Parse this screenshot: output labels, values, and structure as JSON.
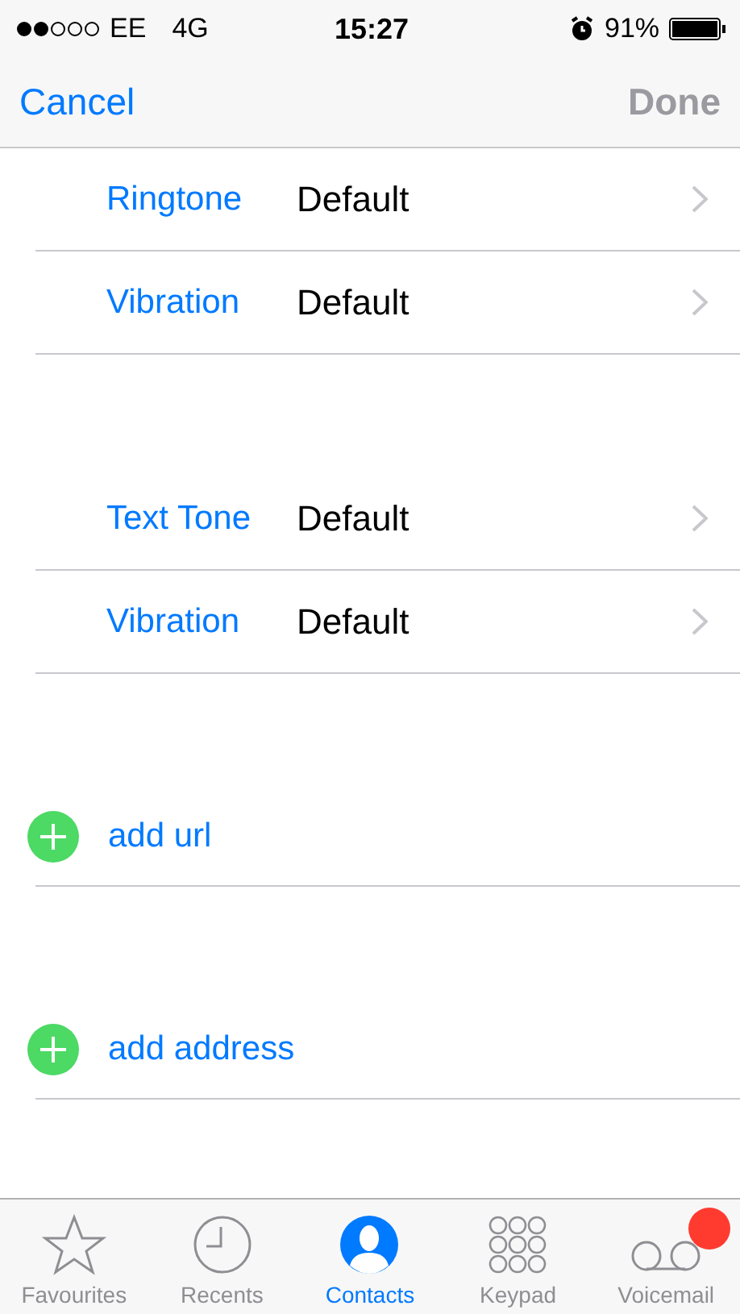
{
  "status_bar": {
    "carrier": "EE",
    "network": "4G",
    "time": "15:27",
    "battery": "91%"
  },
  "nav": {
    "cancel": "Cancel",
    "done": {
      "label": "Done",
      "disabled": true
    }
  },
  "groups": [
    {
      "kind": "settings",
      "rows": [
        {
          "label": "Ringtone",
          "value": "Default"
        },
        {
          "label": "Vibration",
          "value": "Default"
        }
      ]
    },
    {
      "kind": "settings",
      "rows": [
        {
          "label": "Text Tone",
          "value": "Default"
        },
        {
          "label": "Vibration",
          "value": "Default"
        }
      ]
    },
    {
      "kind": "add",
      "rows": [
        {
          "label": "add url"
        }
      ]
    },
    {
      "kind": "add",
      "rows": [
        {
          "label": "add address"
        }
      ]
    }
  ],
  "tabs": [
    {
      "label": "Favourites",
      "kind": "star",
      "selected": false,
      "badge": false
    },
    {
      "label": "Recents",
      "kind": "clock",
      "selected": false,
      "badge": false
    },
    {
      "label": "Contacts",
      "kind": "person",
      "selected": true,
      "badge": false
    },
    {
      "label": "Keypad",
      "kind": "keypad",
      "selected": false,
      "badge": false
    },
    {
      "label": "Voicemail",
      "kind": "voicemail",
      "selected": false,
      "badge": true
    }
  ]
}
